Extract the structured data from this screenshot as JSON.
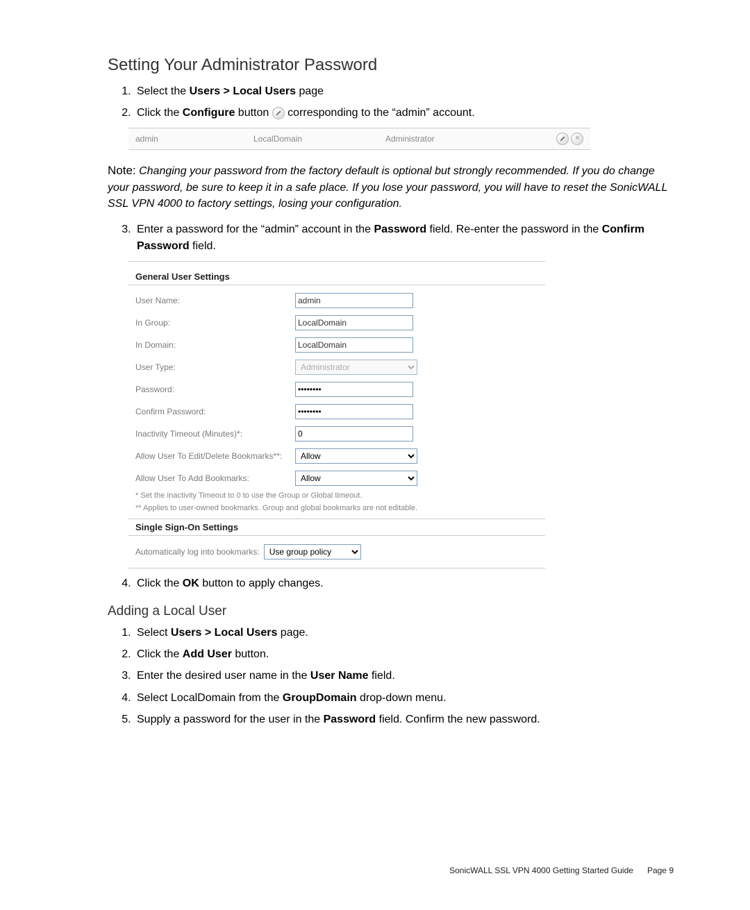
{
  "headings": {
    "h1": "Setting Your Administrator Password",
    "h2": "Adding a Local User"
  },
  "section1": {
    "items": [
      {
        "pre": "Select the ",
        "b": "Users > Local Users",
        "post": " page"
      },
      {
        "pre": "Click the ",
        "b": "Configure",
        "post_a": " button ",
        "post_b": " corresponding to the “admin” account."
      },
      {
        "pre": "Enter a password for the “admin” account in the ",
        "b": "Password",
        "post_a": " field. Re-enter the password in the ",
        "b2": "Confirm Password",
        "post_b": " field."
      },
      {
        "pre": "Click the ",
        "b": "OK",
        "post": " button to apply changes."
      }
    ]
  },
  "admin_row": {
    "user": "admin",
    "domain": "LocalDomain",
    "role": "Administrator"
  },
  "note": {
    "label": "Note:",
    "text": "Changing your password from the factory default is optional but strongly recommended. If you do change your password, be sure to keep it in a safe place. If you lose your password, you will have to reset the SonicWALL SSL VPN 4000 to factory settings, losing your configuration."
  },
  "form": {
    "title1": "General User Settings",
    "labels": {
      "user_name": "User Name:",
      "in_group": "In Group:",
      "in_domain": "In Domain:",
      "user_type": "User Type:",
      "password": "Password:",
      "confirm": "Confirm Password:",
      "inactivity": "Inactivity Timeout (Minutes)*:",
      "edit_bm": "Allow User To Edit/Delete Bookmarks**:",
      "add_bm": "Allow User To Add Bookmarks:"
    },
    "values": {
      "user_name": "admin",
      "in_group": "LocalDomain",
      "in_domain": "LocalDomain",
      "user_type": "Administrator",
      "password": "••••••••",
      "confirm": "••••••••",
      "inactivity": "0",
      "edit_bm": "Allow",
      "add_bm": "Allow"
    },
    "footnote1": "* Set the Inactivity Timeout to 0 to use the Group or Global timeout.",
    "footnote2": "** Applies to user-owned bookmarks. Group and global bookmarks are not editable.",
    "title2": "Single Sign-On Settings",
    "sso_label": "Automatically log into bookmarks:",
    "sso_value": "Use group policy"
  },
  "section2": {
    "items": [
      {
        "pre": "Select ",
        "b": "Users > Local Users",
        "post": " page."
      },
      {
        "pre": "Click the ",
        "b": "Add User",
        "post": " button."
      },
      {
        "pre": "Enter the desired user name in the ",
        "b": "User Name",
        "post": " field."
      },
      {
        "pre": "Select LocalDomain from the ",
        "b": "GroupDomain",
        "post": " drop-down menu."
      },
      {
        "pre": "Supply a password for the user in the ",
        "b": "Password",
        "post": " field. Confirm the new password."
      }
    ]
  },
  "footer": {
    "title": "SonicWALL SSL VPN 4000 Getting Started Guide",
    "page": "Page 9"
  }
}
